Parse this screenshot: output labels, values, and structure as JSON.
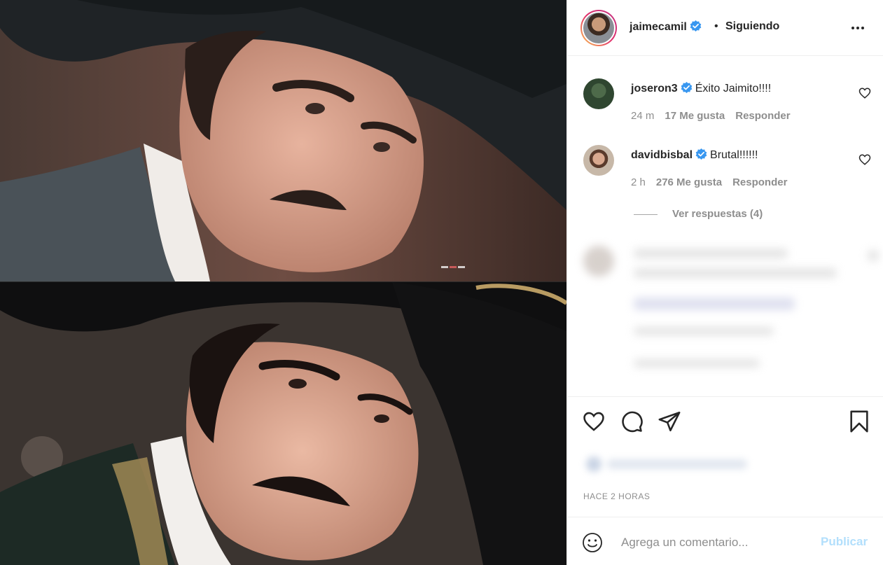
{
  "post": {
    "username": "jaimecamil",
    "follow_status": "Siguiendo",
    "separator": "•",
    "more_label": "•••"
  },
  "comments": [
    {
      "username": "joseron3",
      "text": "Éxito Jaimito!!!!",
      "time": "24 m",
      "likes": "17 Me gusta",
      "reply": "Responder"
    },
    {
      "username": "davidbisbal",
      "text": "Brutal!!!!!!",
      "time": "2 h",
      "likes": "276 Me gusta",
      "reply": "Responder"
    }
  ],
  "view_replies": "Ver respuestas (4)",
  "timestamp": "HACE 2 HORAS",
  "add_comment": {
    "placeholder": "Agrega un comentario...",
    "publish_label": "Publicar"
  },
  "colors": {
    "verified": "#3897f0",
    "publish": "#b2dffc",
    "muted": "#8e8e8e",
    "text": "#262626"
  },
  "icons": [
    "verified-icon",
    "more-icon",
    "heart-icon",
    "comment-icon",
    "share-icon",
    "save-icon",
    "emoji-icon"
  ]
}
